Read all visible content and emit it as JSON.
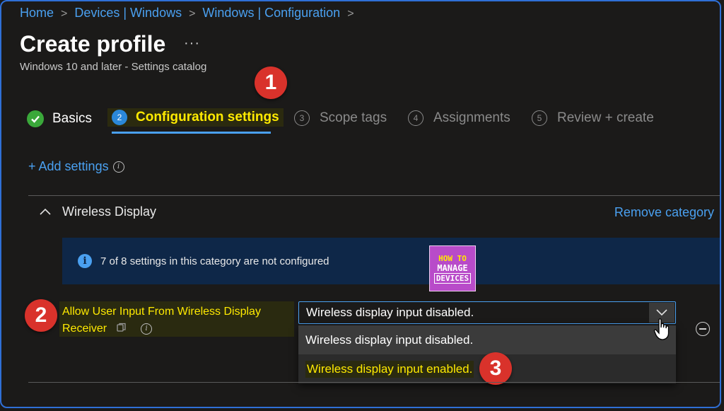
{
  "breadcrumb": [
    "Home",
    "Devices | Windows",
    "Windows | Configuration"
  ],
  "page": {
    "title": "Create profile",
    "more": "···",
    "subtitle": "Windows 10 and later - Settings catalog"
  },
  "steps": [
    {
      "num": "",
      "label": "Basics",
      "state": "done"
    },
    {
      "num": "2",
      "label": "Configuration settings",
      "state": "active"
    },
    {
      "num": "3",
      "label": "Scope tags",
      "state": "inactive"
    },
    {
      "num": "4",
      "label": "Assignments",
      "state": "inactive"
    },
    {
      "num": "5",
      "label": "Review + create",
      "state": "inactive"
    }
  ],
  "add_settings": "+ Add settings",
  "category": {
    "name": "Wireless Display",
    "remove": "Remove category",
    "banner": "7 of 8 settings in this category are not configured"
  },
  "logo": {
    "line1": "HOW TO",
    "line2": "MANAGE",
    "line3": "DEVICES"
  },
  "setting": {
    "label_line1": "Allow User Input From Wireless Display",
    "label_line2": "Receiver",
    "selected": "Wireless display input disabled.",
    "options": [
      "Wireless display input disabled.",
      "Wireless display input enabled."
    ]
  },
  "callouts": [
    "1",
    "2",
    "3"
  ],
  "colors": {
    "accent": "#4aa0f0",
    "highlight": "#ffea00",
    "callout": "#d9322b",
    "success": "#3aa83a"
  }
}
